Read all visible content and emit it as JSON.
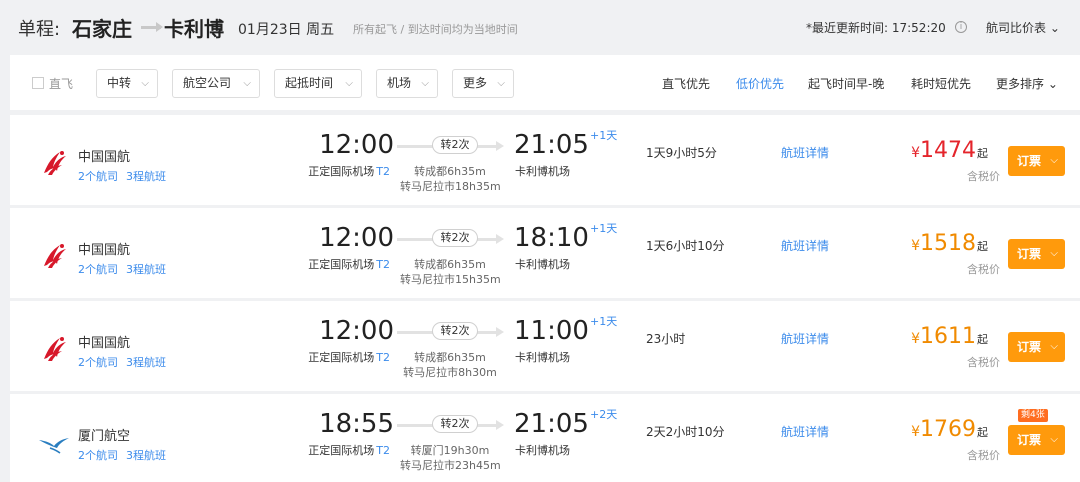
{
  "header": {
    "label": "单程:",
    "from": "石家庄",
    "to": "卡利博",
    "date": "01月23日 周五",
    "note": "所有起飞 / 到达时间均为当地时间",
    "updated": "*最近更新时间: 17:52:20",
    "compare": "航司比价表"
  },
  "filters": {
    "direct_label": "直飞",
    "dropdowns": [
      "中转",
      "航空公司",
      "起抵时间",
      "机场",
      "更多"
    ],
    "sorts": [
      "直飞优先",
      "低价优先",
      "起飞时间早-晚",
      "耗时短优先",
      "更多排序"
    ]
  },
  "colors": {
    "accent_blue": "#3b8beb",
    "price_orange": "#f08a00",
    "price_red": "#e4242b",
    "book_button": "#ff9a0c",
    "air_china_red": "#d7182a",
    "xiamen_blue": "#2a7ec0"
  },
  "flights": [
    {
      "airline": "中国国航",
      "logo_icon": "air-china-phoenix-icon",
      "link_a": "2个航司",
      "link_b": "3程航班",
      "dep_time": "12:00",
      "dep_airport": "正定国际机场",
      "dep_terminal": "T2",
      "stops": "转2次",
      "stop1": "转成都6h35m",
      "stop2": "转马尼拉市18h35m",
      "arr_time": "21:05",
      "day_plus": "+1天",
      "arr_airport": "卡利博机场",
      "duration": "1天9小时5分",
      "details": "航班详情",
      "currency": "¥",
      "price": "1474",
      "qi": "起",
      "tax": "含税价",
      "book": "订票"
    },
    {
      "airline": "中国国航",
      "logo_icon": "air-china-phoenix-icon",
      "link_a": "2个航司",
      "link_b": "3程航班",
      "dep_time": "12:00",
      "dep_airport": "正定国际机场",
      "dep_terminal": "T2",
      "stops": "转2次",
      "stop1": "转成都6h35m",
      "stop2": "转马尼拉市15h35m",
      "arr_time": "18:10",
      "day_plus": "+1天",
      "arr_airport": "卡利博机场",
      "duration": "1天6小时10分",
      "details": "航班详情",
      "currency": "¥",
      "price": "1518",
      "qi": "起",
      "tax": "含税价",
      "book": "订票"
    },
    {
      "airline": "中国国航",
      "logo_icon": "air-china-phoenix-icon",
      "link_a": "2个航司",
      "link_b": "3程航班",
      "dep_time": "12:00",
      "dep_airport": "正定国际机场",
      "dep_terminal": "T2",
      "stops": "转2次",
      "stop1": "转成都6h35m",
      "stop2": "转马尼拉市8h30m",
      "arr_time": "11:00",
      "day_plus": "+1天",
      "arr_airport": "卡利博机场",
      "duration": "23小时",
      "details": "航班详情",
      "currency": "¥",
      "price": "1611",
      "qi": "起",
      "tax": "含税价",
      "book": "订票"
    },
    {
      "airline": "厦门航空",
      "logo_icon": "xiamen-airlines-egret-icon",
      "link_a": "2个航司",
      "link_b": "3程航班",
      "dep_time": "18:55",
      "dep_airport": "正定国际机场",
      "dep_terminal": "T2",
      "stops": "转2次",
      "stop1": "转厦门19h30m",
      "stop2": "转马尼拉市23h45m",
      "arr_time": "21:05",
      "day_plus": "+2天",
      "arr_airport": "卡利博机场",
      "duration": "2天2小时10分",
      "details": "航班详情",
      "currency": "¥",
      "price": "1769",
      "qi": "起",
      "tax": "含税价",
      "book": "订票",
      "badge": "剩4张"
    }
  ]
}
